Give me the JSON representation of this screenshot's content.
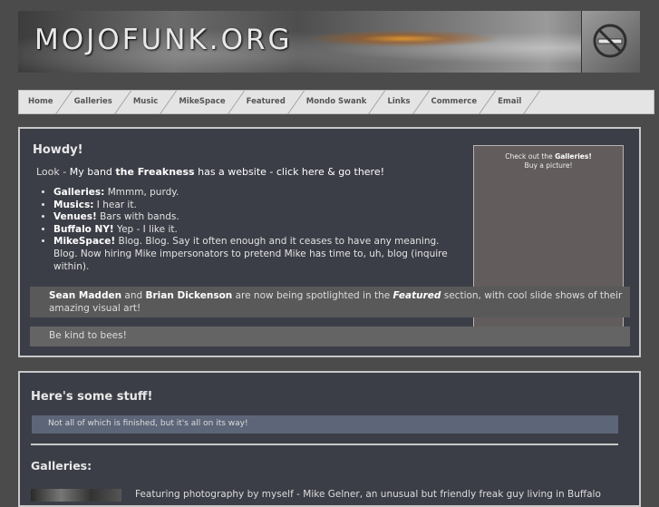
{
  "banner": {
    "title": "MOJOFUNK.ORG"
  },
  "nav": {
    "items": [
      "Home",
      "Galleries",
      "Music",
      "MikeSpace",
      "Featured",
      "Mondo Swank",
      "Links",
      "Commerce",
      "Email"
    ]
  },
  "panel1": {
    "heading": "Howdy!",
    "look": {
      "prefix": "Look - ",
      "text1": "My band ",
      "band": "the Freakness",
      "text2": " has a website - click here & go there!"
    },
    "features": [
      {
        "label": "Galleries:",
        "text": " Mmmm, purdy."
      },
      {
        "label": "Musics:",
        "text": " I hear it."
      },
      {
        "label": "Venues!",
        "text": " Bars with bands."
      },
      {
        "label": "Buffalo NY!",
        "text": " Yep - I like it."
      },
      {
        "label": "MikeSpace!",
        "text": " Blog. Blog. Say it often enough and it ceases to have any meaning. Blog. Now hiring Mike impersonators to pretend Mike has time to, uh, blog (inquire within)."
      }
    ],
    "sidebox": {
      "line1_prefix": "Check out the ",
      "line1_link": "Galleries!",
      "line2": "Buy a picture!"
    },
    "spotlight": {
      "name1": "Sean Madden",
      "and": " and ",
      "name2": "Brian Dickenson",
      "mid": " are now being spotlighted in the ",
      "section": "Featured",
      "end": " section, with cool slide shows of their amazing visual art!"
    },
    "bees": "Be kind to bees!"
  },
  "panel2": {
    "heading": "Here's some stuff!",
    "note": "Not all of which is finished, but it's all on its way!",
    "galleries_heading": "Galleries:",
    "galleries_desc": "Featuring photography by myself - Mike Gelner, an unusual but friendly freak guy living in Buffalo"
  }
}
